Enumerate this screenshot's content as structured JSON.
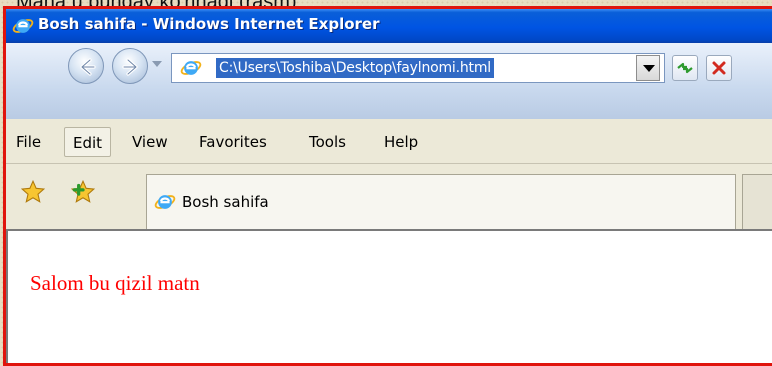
{
  "caption": "Mana u bunday ko'rinadi (rasm)",
  "window": {
    "title": "Bosh sahifa - Windows Internet Explorer"
  },
  "address": {
    "url": "C:\\Users\\Toshiba\\Desktop\\faylnomi.html"
  },
  "menu": {
    "items": [
      "File",
      "Edit",
      "View",
      "Favorites",
      "Tools",
      "Help"
    ],
    "active": "Edit"
  },
  "tab": {
    "label": "Bosh sahifa"
  },
  "page": {
    "text": "Salom bu qizil matn"
  },
  "colors": {
    "border_accent": "#e0140c",
    "page_text": "#ff0000",
    "titlebar": "#0054e3",
    "url_selection": "#316ac5"
  },
  "icons": [
    "ie-icon",
    "back-icon",
    "forward-icon",
    "refresh-icon",
    "stop-icon",
    "favorites-star-icon",
    "add-favorites-icon"
  ]
}
